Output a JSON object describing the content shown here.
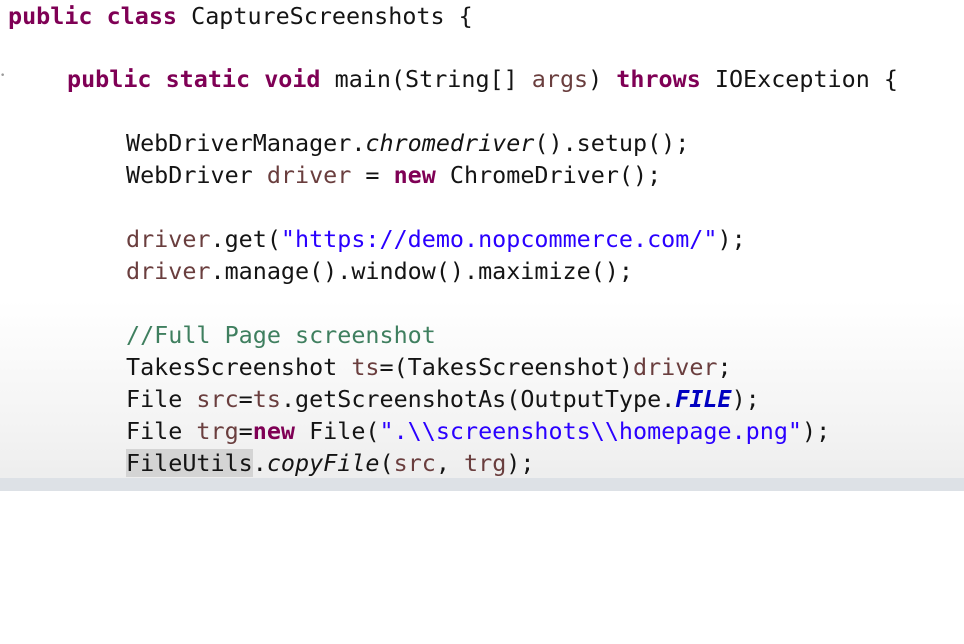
{
  "code": {
    "l1": {
      "kw_public": "public",
      "kw_class": "class",
      "class_name": "CaptureScreenshots {"
    },
    "l2": {
      "kw_public": "public",
      "kw_static": "static",
      "kw_void": "void",
      "sig_start": "main(String[] ",
      "param": "args",
      "sig_close": ") ",
      "kw_throws": "throws",
      "exception": "IOException {"
    },
    "l3": {
      "prefix": "WebDriverManager.",
      "method": "chromedriver",
      "suffix": "().setup();"
    },
    "l4": {
      "type": "WebDriver ",
      "var": "driver",
      "eq": " = ",
      "kw_new": "new",
      "ctor": " ChromeDriver();"
    },
    "l5": {
      "var": "driver",
      "call": ".get(",
      "url": "\"https://demo.nopcommerce.com/\"",
      "end": ");"
    },
    "l6": {
      "var": "driver",
      "call": ".manage().window().maximize();"
    },
    "l7": {
      "comment": "//Full Page screenshot"
    },
    "l8": {
      "type": "TakesScreenshot ",
      "var": "ts",
      "cast": "=(TakesScreenshot)",
      "ref": "driver",
      "end": ";"
    },
    "l9": {
      "type": "File ",
      "var": "src",
      "eq": "=",
      "ref": "ts",
      "call": ".getScreenshotAs(OutputType.",
      "const": "FILE",
      "end": ");"
    },
    "l10": {
      "type": "File ",
      "var": "trg",
      "eq": "=",
      "kw_new": "new",
      "ctor": " File(",
      "path": "\".\\\\screenshots\\\\homepage.png\"",
      "end": ");"
    },
    "l11": {
      "cls": "FileUtils",
      "dot": ".",
      "method": "copyFile",
      "args_open": "(",
      "arg1": "src",
      "comma": ", ",
      "arg2": "trg",
      "end": ");"
    }
  }
}
